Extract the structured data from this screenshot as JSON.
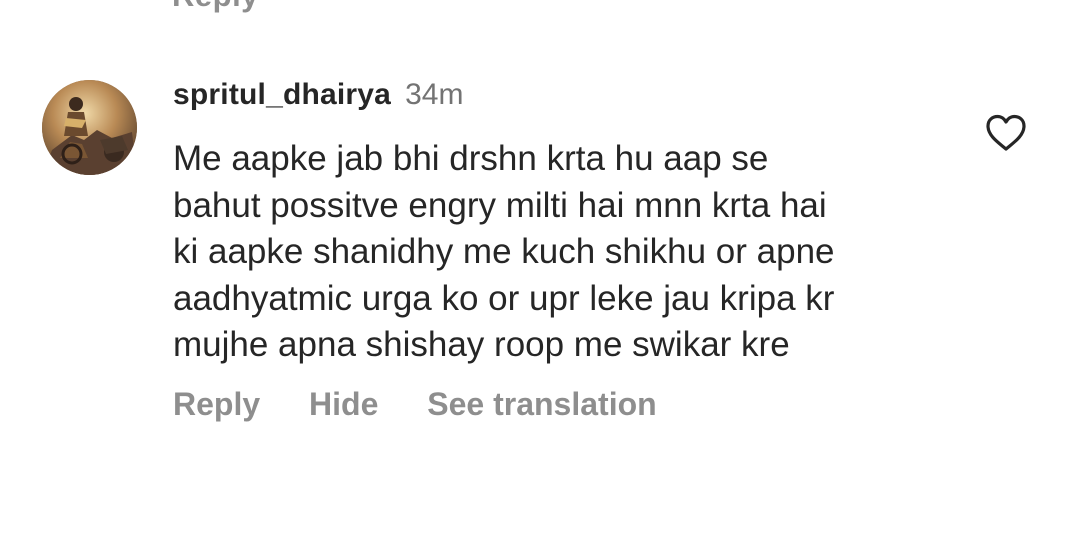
{
  "previous_reply": {
    "fragment": "Reply"
  },
  "comment": {
    "username": "spritul_dhairya",
    "timestamp": "34m",
    "lines": [
      "Me aapke jab bhi drshn krta hu aap se",
      "bahut possitve engry milti hai mnn krta hai",
      "ki aapke shanidhy me kuch shikhu or apne",
      "aadhyatmic urga ko or upr leke jau kripa kr",
      "mujhe apna shishay roop me swikar kre"
    ],
    "actions": {
      "reply": "Reply",
      "hide": "Hide",
      "see_translation": "See translation"
    },
    "like_icon": "heart-outline-icon"
  },
  "colors": {
    "text_primary": "#262626",
    "text_secondary": "#8e8e8e",
    "timestamp": "#737373",
    "background": "#ffffff"
  }
}
